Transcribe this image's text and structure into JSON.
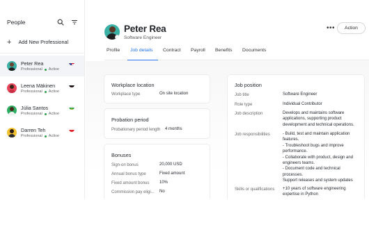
{
  "sidebar": {
    "title": "People",
    "add_label": "Add New Professional",
    "people": [
      {
        "name": "Peter Rea",
        "role": "Professional",
        "status": "Active",
        "active": true
      },
      {
        "name": "Leena Mäkinen",
        "role": "Professional",
        "status": "Active",
        "active": false
      },
      {
        "name": "Júlia Santos",
        "role": "Professional",
        "status": "Active",
        "active": false
      },
      {
        "name": "Darren Teh",
        "role": "Professional",
        "status": "Active",
        "active": false
      }
    ]
  },
  "profile": {
    "name": "Peter Rea",
    "title": "Software Engineer",
    "more_label": "•••",
    "action_label": "Action"
  },
  "tabs": [
    "Profile",
    "Job details",
    "Contract",
    "Payroll",
    "Benefits",
    "Documents"
  ],
  "active_tab": "Job details",
  "workplace": {
    "title": "Workplace location",
    "rows": [
      {
        "label": "Workplace type",
        "value": "On site location"
      }
    ]
  },
  "probation": {
    "title": "Probation period",
    "rows": [
      {
        "label": "Probationary period length",
        "value": "4 months"
      }
    ]
  },
  "bonuses": {
    "title": "Bonuses",
    "rows": [
      {
        "label": "Sign-on bonus",
        "value": "20,000 USD"
      },
      {
        "label": "Annual bonus type",
        "value": "Fixed amount"
      },
      {
        "label": "Fixed amount bonus",
        "value": "10%"
      },
      {
        "label": "Commission pay eligi...",
        "value": "No"
      }
    ]
  },
  "job_position": {
    "title": "Job position",
    "job_title_label": "Job title",
    "job_title_value": "Software Engineer",
    "role_type_label": "Role type",
    "role_type_value": "Individual Contributor",
    "description_label": "Job description",
    "description_lines": [
      "Develops and maintains software",
      "applications, supporting product",
      "development and technical operations."
    ],
    "responsibilities_label": "Job responsibilities",
    "responsibilities_lines": [
      "- Build, test and maintain application",
      "features.",
      "- Troubleshoot bugs and improve",
      "performance.",
      "- Collaborate with product, design and",
      "engineers teams.",
      "- Document code and technical",
      "processes.",
      "Support releases and system updates"
    ],
    "skills_label": "Skills or qualifications",
    "skills_lines": [
      "+10 years of software engineering",
      "expertise in Python"
    ]
  },
  "colors": {
    "accent": "#1f6feb",
    "active_status": "#2e9e4f"
  },
  "icons": [
    "search-icon",
    "filter-icon",
    "plus-icon",
    "more-icon"
  ]
}
